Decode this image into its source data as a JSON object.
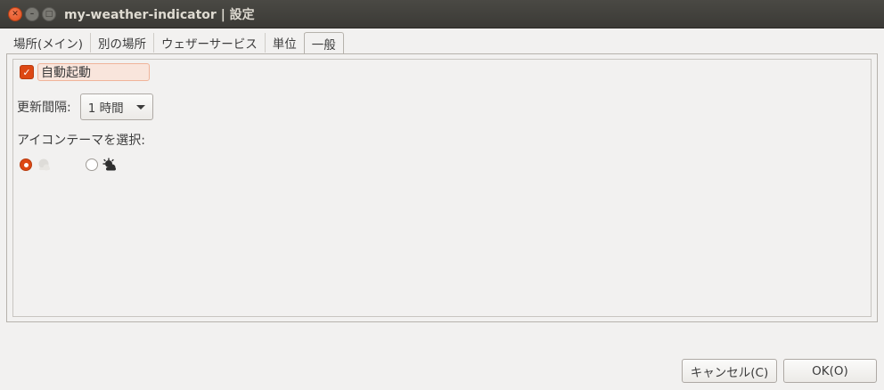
{
  "window": {
    "title": "my-weather-indicator | 設定",
    "close_glyph": "✕",
    "minimize_glyph": "–",
    "maximize_glyph": "□"
  },
  "tabs": [
    {
      "label": "場所(メイン)"
    },
    {
      "label": "別の場所"
    },
    {
      "label": "ウェザーサービス"
    },
    {
      "label": "単位"
    },
    {
      "label": "一般",
      "active": true
    }
  ],
  "general": {
    "autostart": {
      "label": "自動起動",
      "checked": true
    },
    "update_interval": {
      "label": "更新間隔:",
      "value": "1 時間"
    },
    "icon_theme": {
      "label": "アイコンテーマを選択:",
      "options": [
        {
          "icon": "light-weather-icon",
          "selected": true
        },
        {
          "icon": "dark-weather-icon",
          "selected": false
        }
      ]
    }
  },
  "buttons": {
    "cancel": "キャンセル(C)",
    "ok": "OK(O)"
  },
  "colors": {
    "accent": "#dd4814",
    "titlebar": "#3b3a36",
    "background": "#f2f1f0"
  }
}
